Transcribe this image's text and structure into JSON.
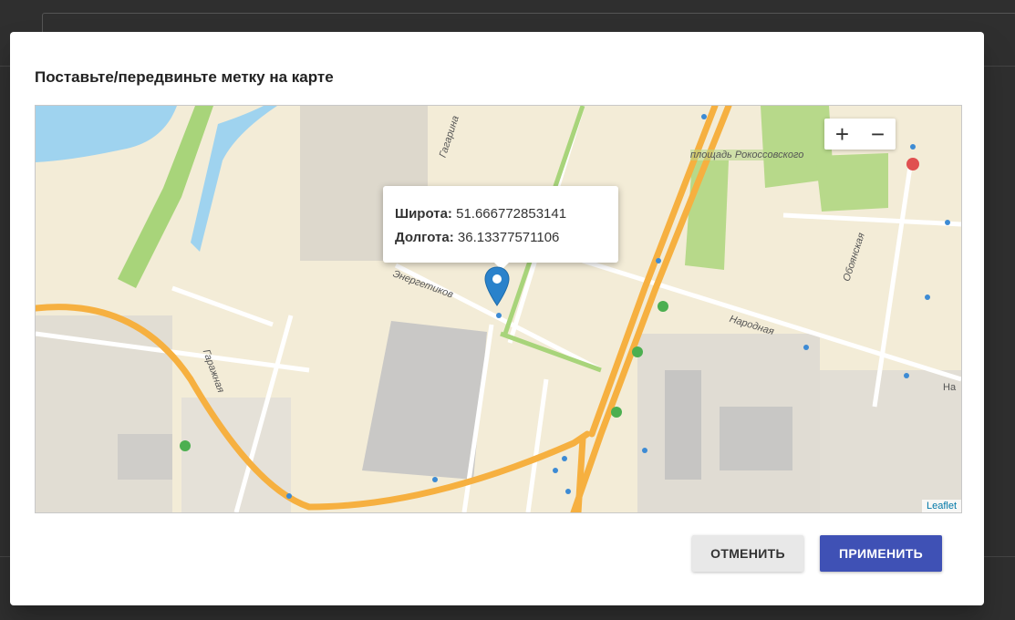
{
  "dialog": {
    "title": "Поставьте/передвиньте метку на карте",
    "cancel_label": "ОТМЕНИТЬ",
    "apply_label": "ПРИМЕНИТЬ"
  },
  "map": {
    "zoom_in": "+",
    "zoom_out": "−",
    "attribution": "Leaflet",
    "popup": {
      "lat_label": "Широта:",
      "lat_value": "51.666772853141",
      "lng_label": "Долгота:",
      "lng_value": "36.13377571106"
    },
    "street_labels": {
      "gagarina": "Гагарина",
      "energetikov": "Энергетиков",
      "garazhnaya": "Гаражная",
      "narodnaya": "Народная",
      "oboyanskaya": "Обоянская",
      "square": "площадь Рокоссовского",
      "na": "На"
    },
    "colors": {
      "land": "#f3ecd7",
      "road_major": "#f6b040",
      "park": "#b7d98a",
      "water": "#9fd3ef",
      "marker": "#2a82cb",
      "accent_button": "#3f51b5"
    }
  }
}
